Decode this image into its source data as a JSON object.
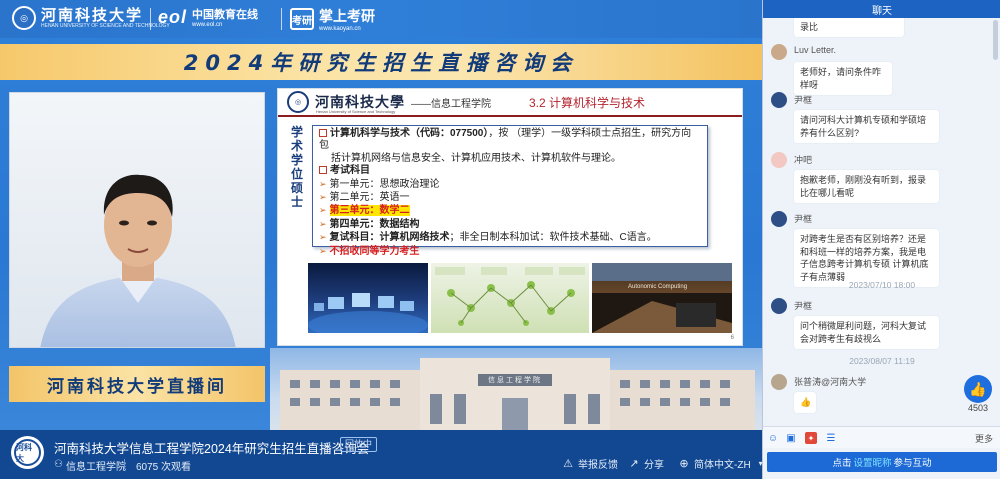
{
  "video": {
    "logos": {
      "hust_name": "河南科技大学",
      "hust_name_en": "HENAN UNIVERSITY OF SCIENCE AND TECHNOLOGY",
      "eol_brand": "eol",
      "eol_cn": "中国教育在线",
      "eol_url": "www.eol.cn",
      "kaoyan_box": "考研",
      "kaoyan_cn": "掌上考研",
      "kaoyan_url": "www.kaoyan.cn"
    },
    "title_banner": "2024年研究生招生直播咨询会",
    "name_plate": "河南科技大学直播间",
    "slide": {
      "school": "河南科技大學",
      "school_en": "Henan University of Science and Technology",
      "dept": "——信息工程学院",
      "section": "3.2 计算机科学与技术",
      "side_label": "学术学位硕士",
      "line1_bold": "计算机科学与技术（代码：077500）",
      "line1_rest": "，按 （理学）一级学科硕士点招生，研究方向包",
      "line2": "括计算机网络与信息安全、计算机应用技术、计算机软件与理论。",
      "exam_heading": "考试科目",
      "unit1": "第一单元：思想政治理论",
      "unit2": "第二单元：英语一",
      "unit3": "第三单元：数学二",
      "unit4": "第四单元：数据结构",
      "retest_bold": "复试科目：计算机网络技术",
      "retest_rest": "；非全日制本科加试：软件技术基础、C语言。",
      "no_equiv": "不招收同等学力考生",
      "img2_caption": "Autonomic Computing",
      "page_num": "6"
    },
    "building_sign": "信息工程学院"
  },
  "bottom_bar": {
    "channel_logo": "河科大",
    "stream_title": "河南科技大学信息工程学院2024年研究生招生直播咨询会",
    "replay_badge": "回放中",
    "org_name": "信息工程学院",
    "views": "6075 次观看",
    "report_label": "举报反馈",
    "share_label": "分享",
    "language_label": "简体中文-ZH"
  },
  "chat": {
    "header": "聊天",
    "messages": [
      {
        "user": "",
        "text": "老师，你好，有没有报录比"
      },
      {
        "user": "Luv Letter.",
        "text": "老师好，请问条件咋样呀"
      },
      {
        "user": "尹框",
        "text": "请问河科大计算机专硕和学硕培养有什么区别?"
      },
      {
        "user": "冲吧",
        "text": "抱歉老师，刚刚没有听到，报录比在哪儿看呢"
      },
      {
        "user": "尹框",
        "text": "对跨考生是否有区别培养？还是和科班一样的培养方案，我是电子信息跨考计算机专硕 计算机底子有点薄弱"
      },
      {
        "user": "尹框",
        "text": "问个稍微犀利问题，河科大复试会对跨考生有歧视么"
      },
      {
        "user": "张普涛@河南大学",
        "text": "👍"
      }
    ],
    "timestamps": [
      "2023/07/10 18:00",
      "2023/08/07 11:19"
    ],
    "like_count": "4503",
    "more_label": "更多",
    "input_prefix": "点击",
    "input_link": "设置昵称",
    "input_suffix": "参与互动"
  },
  "colors": {
    "video_blue": "#2f80d9",
    "banner_gold": "#f6c86b",
    "bar_navy": "#124892",
    "chat_accent": "#1c63c2",
    "slide_red": "#d62020"
  }
}
